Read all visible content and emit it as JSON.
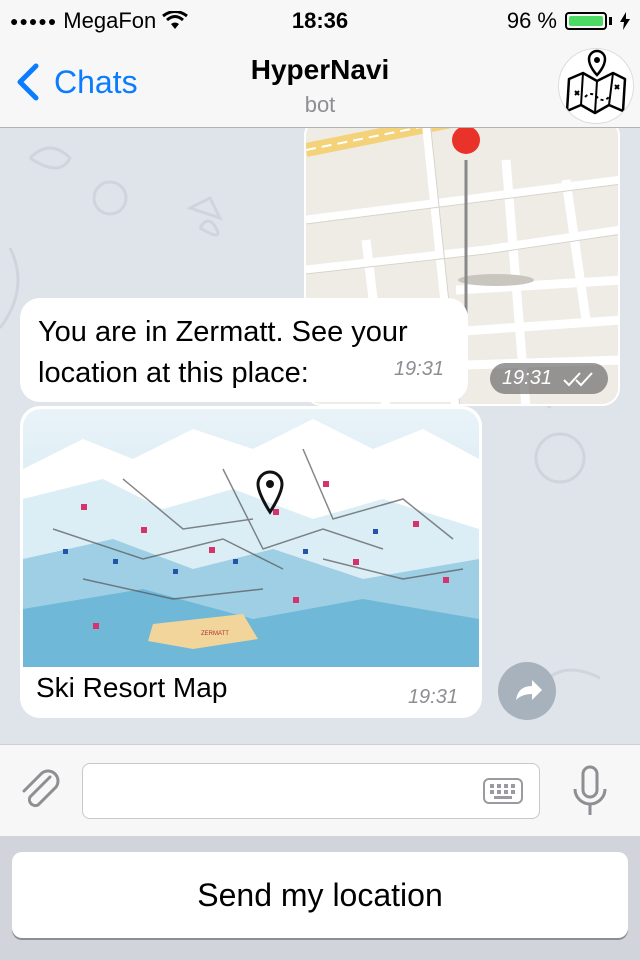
{
  "status_bar": {
    "signal_dots": "●●●●●",
    "carrier": "MegaFon",
    "time": "18:36",
    "battery": "96 %"
  },
  "nav": {
    "back_label": "Chats",
    "title": "HyperNavi",
    "subtitle": "bot"
  },
  "messages": [
    {
      "type": "location",
      "direction": "out",
      "time": "19:31"
    },
    {
      "type": "text",
      "direction": "in",
      "text": "You are in Zermatt. See your location at this place:",
      "time": "19:31"
    },
    {
      "type": "photo",
      "direction": "in",
      "caption": "Ski Resort Map",
      "time": "19:31",
      "map_label": "ZERMATT"
    }
  ],
  "input": {
    "placeholder": ""
  },
  "reply_keyboard": {
    "button_label": "Send my location"
  },
  "colors": {
    "accent": "#0a7cff",
    "battery": "#4cd964",
    "pin": "#e8322a",
    "background": "#dfe4ea"
  }
}
